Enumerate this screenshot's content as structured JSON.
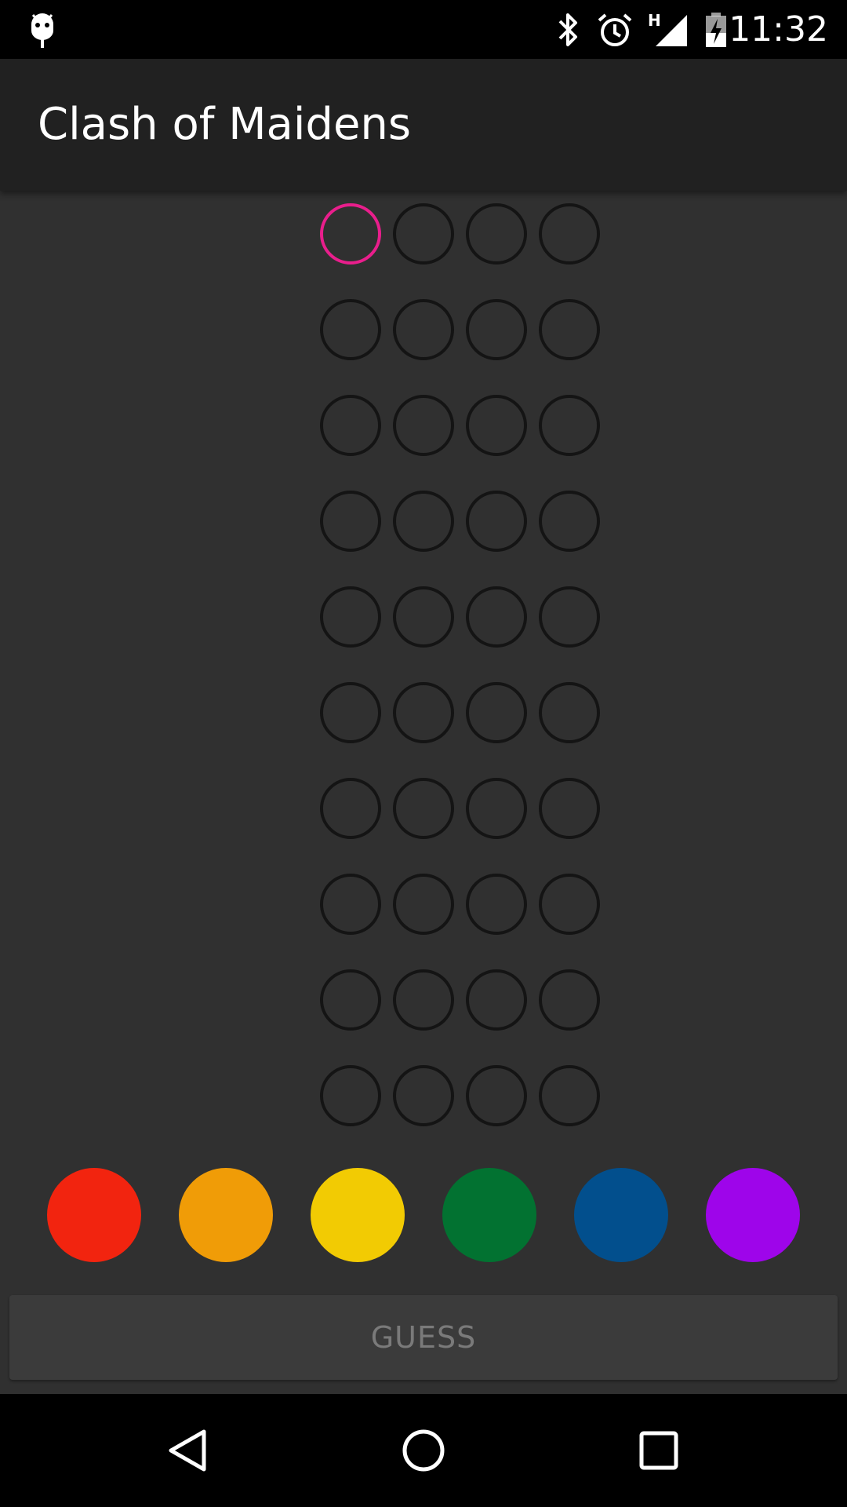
{
  "status_bar": {
    "time": "11:32",
    "network_label": "H",
    "icons": [
      "android-debug-icon",
      "bluetooth-icon",
      "alarm-icon",
      "signal-icon",
      "battery-charging-icon"
    ]
  },
  "app_bar": {
    "title": "Clash of Maidens"
  },
  "board": {
    "rows": 10,
    "columns": 4,
    "selected_slot": {
      "row": 1,
      "column": 1
    },
    "slot_border_color": "#141414",
    "selected_border_color": "#e91e8c"
  },
  "palette": [
    {
      "name": "red",
      "color": "#f2240f"
    },
    {
      "name": "orange",
      "color": "#f09c07"
    },
    {
      "name": "yellow",
      "color": "#f2cb03"
    },
    {
      "name": "green",
      "color": "#027231"
    },
    {
      "name": "blue",
      "color": "#024f8d"
    },
    {
      "name": "purple",
      "color": "#9e05ea"
    }
  ],
  "guess_button": {
    "label": "GUESS"
  },
  "nav_bar": {
    "icons": [
      "back-icon",
      "home-icon",
      "recents-icon"
    ]
  }
}
